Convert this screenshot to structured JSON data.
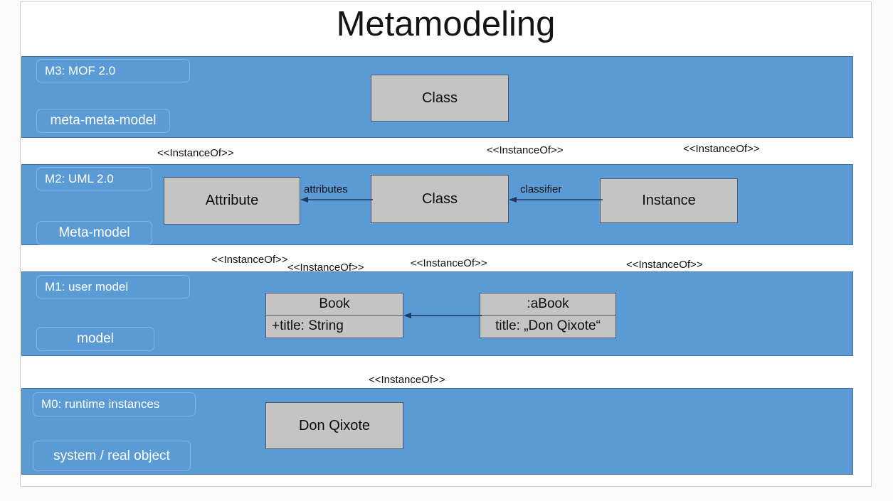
{
  "slide": {
    "title": "Metamodeling",
    "background_color": "#ffffff",
    "band_color": "#5b9bd5",
    "box_color": "#c4c4c4"
  },
  "layers": [
    {
      "id": "m3",
      "level_label": "M3: MOF 2.0",
      "role_label": "meta-meta-model",
      "boxes": [
        {
          "id": "m3-class",
          "name": "Class"
        }
      ]
    },
    {
      "id": "m2",
      "level_label": "M2: UML 2.0",
      "role_label": "Meta-model",
      "boxes": [
        {
          "id": "m2-attribute",
          "name": "Attribute"
        },
        {
          "id": "m2-class",
          "name": "Class"
        },
        {
          "id": "m2-instance",
          "name": "Instance"
        }
      ],
      "associations": [
        {
          "id": "assoc-attributes",
          "label": "attributes",
          "from": "m2-class",
          "to": "m2-attribute"
        },
        {
          "id": "assoc-classifier",
          "label": "classifier",
          "from": "m2-instance",
          "to": "m2-class"
        }
      ]
    },
    {
      "id": "m1",
      "level_label": "M1: user model",
      "role_label": "model",
      "boxes": [
        {
          "id": "m1-book",
          "name": "Book",
          "attribute": "+title: String"
        },
        {
          "id": "m1-abook",
          "name": ":aBook",
          "attribute": "title: „Don Qixote“"
        }
      ],
      "associations": [
        {
          "id": "assoc-abook-book",
          "label": "",
          "from": "m1-abook",
          "to": "m1-book"
        }
      ]
    },
    {
      "id": "m0",
      "level_label": "M0: runtime instances",
      "role_label": "system / real object",
      "boxes": [
        {
          "id": "m0-don-qixote",
          "name": "Don Qixote"
        }
      ]
    }
  ],
  "stereotypes": [
    {
      "id": "st-1",
      "text": "<<InstanceOf>>"
    },
    {
      "id": "st-2",
      "text": "<<InstanceOf>>"
    },
    {
      "id": "st-3",
      "text": "<<InstanceOf>>"
    },
    {
      "id": "st-4",
      "text": "<<InstanceOf>>"
    },
    {
      "id": "st-5",
      "text": "<<InstanceOf>>"
    },
    {
      "id": "st-6",
      "text": "<<InstanceOf>>"
    },
    {
      "id": "st-7",
      "text": "<<InstanceOf>>"
    },
    {
      "id": "st-8",
      "text": "<<InstanceOf>>"
    }
  ]
}
